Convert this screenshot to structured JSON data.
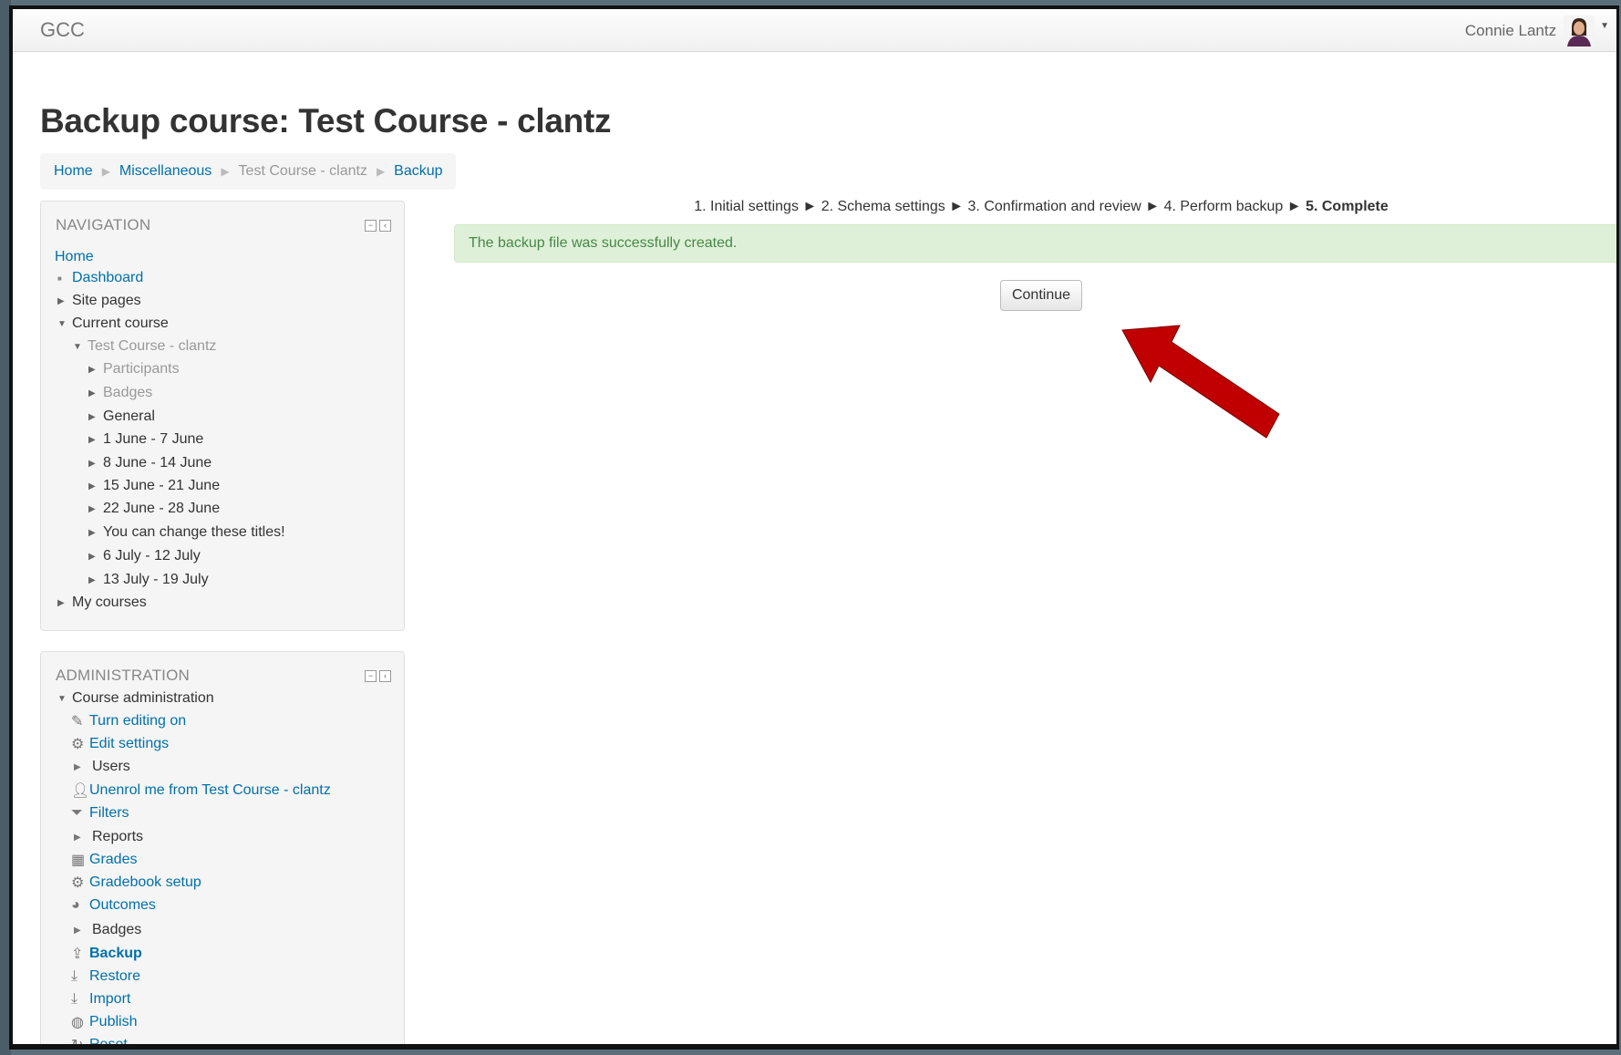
{
  "navbar": {
    "brand": "GCC",
    "user_name": "Connie Lantz"
  },
  "page": {
    "title": "Backup course: Test Course - clantz"
  },
  "breadcrumb": {
    "home": "Home",
    "category": "Miscellaneous",
    "course": "Test Course - clantz",
    "current": "Backup",
    "separator": "▶"
  },
  "navigation": {
    "title": "NAVIGATION",
    "home": "Home",
    "dashboard": "Dashboard",
    "site_pages": "Site pages",
    "current_course": "Current course",
    "course_name": "Test Course - clantz",
    "participants": "Participants",
    "badges": "Badges",
    "general": "General",
    "week1": "1 June - 7 June",
    "week2": "8 June - 14 June",
    "week3": "15 June - 21 June",
    "week4": "22 June - 28 June",
    "week5": "You can change these titles!",
    "week6": "6 July - 12 July",
    "week7": "13 July - 19 July",
    "my_courses": "My courses"
  },
  "administration": {
    "title": "ADMINISTRATION",
    "course_admin": "Course administration",
    "turn_editing": "Turn editing on",
    "edit_settings": "Edit settings",
    "users": "Users",
    "unenrol": "Unenrol me from Test Course - clantz",
    "filters": "Filters",
    "reports": "Reports",
    "grades": "Grades",
    "gradebook_setup": "Gradebook setup",
    "outcomes": "Outcomes",
    "badges": "Badges",
    "backup": "Backup",
    "restore": "Restore",
    "import": "Import",
    "publish": "Publish",
    "reset": "Reset"
  },
  "progress": {
    "step1": "1. Initial settings",
    "step2": "2. Schema settings",
    "step3": "3. Confirmation and review",
    "step4": "4. Perform backup",
    "step5": "5. Complete",
    "separator": "►"
  },
  "notification": {
    "message": "The backup file was successfully created."
  },
  "actions": {
    "continue_label": "Continue"
  },
  "colors": {
    "link": "#0070a8",
    "alert_bg": "#dff0d8",
    "alert_text": "#468847",
    "arrow": "#c00000"
  }
}
